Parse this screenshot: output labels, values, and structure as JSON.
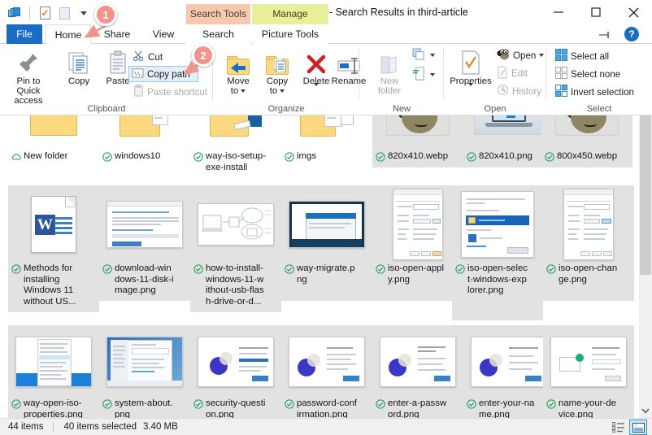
{
  "window": {
    "title": ". - Search Results in third-article",
    "minimize_label": "Minimize",
    "maximize_label": "Maximize",
    "close_label": "Close"
  },
  "quick_access_toolbar": {
    "items": [
      {
        "name": "explorer-icon",
        "label": "File Explorer"
      },
      {
        "name": "properties-icon",
        "label": "Properties"
      },
      {
        "name": "new-folder-icon",
        "label": "New folder"
      },
      {
        "name": "customize-caret-icon",
        "label": "Customize Quick Access Toolbar"
      }
    ]
  },
  "context_tabs": [
    {
      "id": "search-tools",
      "label": "Search Tools",
      "color": "#f6c9ae"
    },
    {
      "id": "manage",
      "label": "Manage",
      "color": "#e9ee98"
    }
  ],
  "tabs": [
    {
      "id": "file",
      "label": "File",
      "active": false
    },
    {
      "id": "home",
      "label": "Home",
      "active": true
    },
    {
      "id": "share",
      "label": "Share",
      "active": false
    },
    {
      "id": "view",
      "label": "View",
      "active": false
    },
    {
      "id": "search",
      "label": "Search",
      "active": false
    },
    {
      "id": "picture-tools",
      "label": "Picture Tools",
      "active": false
    }
  ],
  "ribbon_help": {
    "collapse_label": "Collapse the Ribbon",
    "help_label": "?"
  },
  "ribbon": {
    "groups": [
      {
        "id": "clipboard",
        "label": "Clipboard",
        "big_buttons": [
          {
            "id": "pin-to-quick-access",
            "label": "Pin to Quick\naccess",
            "line1": "Pin to Quick",
            "line2": "access",
            "disabled": false
          },
          {
            "id": "copy",
            "label": "Copy",
            "line1": "Copy",
            "line2": "",
            "disabled": false
          },
          {
            "id": "paste",
            "label": "Paste",
            "line1": "Paste",
            "line2": "",
            "disabled": false
          }
        ],
        "small_buttons": [
          {
            "id": "cut",
            "label": "Cut",
            "disabled": false,
            "selected": false
          },
          {
            "id": "copy-path",
            "label": "Copy path",
            "disabled": false,
            "selected": true
          },
          {
            "id": "paste-shortcut",
            "label": "Paste shortcut",
            "disabled": true,
            "selected": false
          }
        ]
      },
      {
        "id": "organize",
        "label": "Organize",
        "big_buttons": [
          {
            "id": "move-to",
            "line1": "Move",
            "line2": "to",
            "disabled": false,
            "has_caret": true
          },
          {
            "id": "copy-to",
            "line1": "Copy",
            "line2": "to",
            "disabled": false,
            "has_caret": true
          },
          {
            "id": "delete",
            "line1": "Delete",
            "line2": "",
            "disabled": false,
            "has_caret": true
          },
          {
            "id": "rename",
            "line1": "Rename",
            "line2": "",
            "disabled": false,
            "has_caret": false
          }
        ]
      },
      {
        "id": "new",
        "label": "New",
        "big_buttons": [
          {
            "id": "new-folder",
            "line1": "New",
            "line2": "folder",
            "disabled": true,
            "has_caret": false
          }
        ],
        "small_buttons": [
          {
            "id": "new-item",
            "label": "",
            "disabled": false
          },
          {
            "id": "easy-access",
            "label": "",
            "disabled": false
          }
        ]
      },
      {
        "id": "open",
        "label": "Open",
        "big_buttons": [
          {
            "id": "properties",
            "line1": "Properties",
            "line2": "",
            "disabled": false,
            "has_caret": true
          }
        ],
        "small_buttons": [
          {
            "id": "open",
            "label": "Open",
            "disabled": false,
            "has_caret": true
          },
          {
            "id": "edit",
            "label": "Edit",
            "disabled": true
          },
          {
            "id": "history",
            "label": "History",
            "disabled": true
          }
        ]
      },
      {
        "id": "select",
        "label": "Select",
        "small_buttons": [
          {
            "id": "select-all",
            "label": "Select all",
            "disabled": false
          },
          {
            "id": "select-none",
            "label": "Select none",
            "disabled": false
          },
          {
            "id": "invert-selection",
            "label": "Invert selection",
            "disabled": false
          }
        ]
      }
    ]
  },
  "callouts": [
    {
      "id": "callout-1",
      "number": "1",
      "target": "Home tab"
    },
    {
      "id": "callout-2",
      "number": "2",
      "target": "Copy path"
    }
  ],
  "files": {
    "rows": [
      {
        "row": 1,
        "items": [
          {
            "name": "New folder",
            "kind": "folder",
            "badge": "cloud",
            "selected": false,
            "lines": [
              "New folder"
            ]
          },
          {
            "name": "windows10",
            "kind": "folder-pic",
            "badge": "check",
            "selected": false,
            "lines": [
              "windows10"
            ]
          },
          {
            "name": "way-iso-setup-exe-install",
            "kind": "folder-exe",
            "badge": "check",
            "selected": false,
            "lines": [
              "way-iso-setup-",
              "exe-install"
            ]
          },
          {
            "name": "imgs",
            "kind": "folder-doc",
            "badge": "check",
            "selected": false,
            "lines": [
              "imgs"
            ]
          },
          {
            "name": "820x410.webp",
            "kind": "wilber",
            "badge": "check",
            "selected": true,
            "lines": [
              "820x410.webp"
            ]
          },
          {
            "name": "820x410.png",
            "kind": "laptop",
            "badge": "check",
            "selected": true,
            "lines": [
              "820x410.png"
            ]
          },
          {
            "name": "800x450.webp",
            "kind": "wilber",
            "badge": "check",
            "selected": true,
            "lines": [
              "800x450.webp"
            ]
          }
        ]
      },
      {
        "row": 2,
        "items": [
          {
            "name": "Methods for installing Windows 11 without US...",
            "kind": "word",
            "badge": "check",
            "selected": true,
            "lines": [
              "Methods for",
              "installing",
              "Windows 11",
              "without US..."
            ]
          },
          {
            "name": "download-windows-11-disk-image.png",
            "kind": "browser",
            "badge": "check",
            "selected": true,
            "lines": [
              "download-win",
              "dows-11-disk-i",
              "mage.png"
            ]
          },
          {
            "name": "how-to-install-windows-11-without-usb-flash-drive-or-d...",
            "kind": "diagram",
            "badge": "check",
            "selected": true,
            "lines": [
              "how-to-install-",
              "windows-11-w",
              "ithout-usb-flas",
              "h-drive-or-d..."
            ]
          },
          {
            "name": "way-migrate.png",
            "kind": "dialog-blue",
            "badge": "check",
            "selected": true,
            "lines": [
              "way-migrate.p",
              "ng"
            ]
          },
          {
            "name": "iso-open-apply.png",
            "kind": "props-dialog",
            "badge": "check",
            "selected": true,
            "lines": [
              "iso-open-appl",
              "y.png"
            ]
          },
          {
            "name": "iso-open-select-windows-explorer.png",
            "kind": "openwith-dialog",
            "badge": "check",
            "selected": true,
            "lines": [
              "iso-open-selec",
              "t-windows-exp",
              "lorer.png"
            ]
          },
          {
            "name": "iso-open-change.png",
            "kind": "props-dialog",
            "badge": "check",
            "selected": true,
            "lines": [
              "iso-open-chan",
              "ge.png"
            ]
          }
        ]
      },
      {
        "row": 3,
        "items": [
          {
            "name": "way-open-iso-properties.png",
            "kind": "ctxmenu",
            "badge": "check",
            "selected": true,
            "lines": [
              "way-open-iso-",
              "properties.png"
            ]
          },
          {
            "name": "system-about.png",
            "kind": "settings-win",
            "badge": "check",
            "selected": true,
            "lines": [
              "system-about.",
              "png"
            ]
          },
          {
            "name": "security-question.png",
            "kind": "oobe",
            "badge": "check",
            "selected": true,
            "lines": [
              "security-questi",
              "on.png"
            ]
          },
          {
            "name": "password-confirmation.png",
            "kind": "oobe",
            "badge": "check",
            "selected": true,
            "lines": [
              "password-conf",
              "irmation.png"
            ]
          },
          {
            "name": "enter-a-password.png",
            "kind": "oobe",
            "badge": "check",
            "selected": true,
            "lines": [
              "enter-a-passw",
              "ord.png"
            ]
          },
          {
            "name": "enter-your-name.png",
            "kind": "oobe",
            "badge": "check",
            "selected": true,
            "lines": [
              "enter-your-na",
              "me.png"
            ]
          },
          {
            "name": "name-your-device.png",
            "kind": "oobe-device",
            "badge": "check",
            "selected": true,
            "lines": [
              "name-your-de",
              "vice.png"
            ]
          }
        ]
      }
    ]
  },
  "status_bar": {
    "item_count": "44 items",
    "selected_count": "40 items selected",
    "size": "3.40 MB",
    "view_details_label": "Details view",
    "view_large_icons_label": "Large icons view"
  },
  "scrollbar": {
    "down_arrow": "⌄"
  },
  "colors": {
    "accent": "#1a6dc0",
    "selection": "#e2e2e2",
    "callout": "#f2938c",
    "search_tools_tab": "#f6c9ae",
    "manage_tab": "#e9ee98",
    "sync_check": "#1f9d55",
    "cloud": "#2a7fd4"
  }
}
